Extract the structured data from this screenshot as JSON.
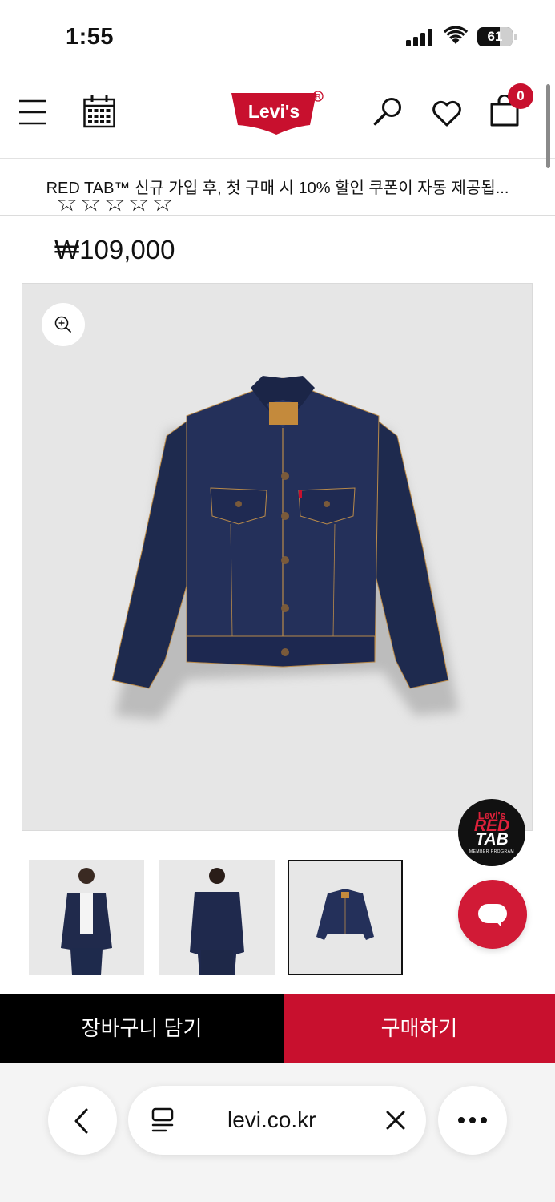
{
  "status_bar": {
    "time": "1:55",
    "battery": "61"
  },
  "header": {
    "menu_icon": "hamburger-icon",
    "calendar_icon": "calendar-icon",
    "logo_text": "Levi's",
    "search_icon": "search-icon",
    "wishlist_icon": "heart-icon",
    "cart_icon": "shopping-bag-icon",
    "cart_count": "0",
    "brand_color": "#c8102e"
  },
  "promo": {
    "text": "RED TAB™ 신규 가입 후, 첫 구매 시 10% 할인 쿠폰이 자동 제공됩..."
  },
  "product": {
    "rating_stars": [
      "☆",
      "☆",
      "☆",
      "☆",
      "☆"
    ],
    "price": "₩109,000",
    "zoom_icon": "zoom-in-icon"
  },
  "floating": {
    "red_tab_line1": "Levi's",
    "red_tab_line2": "RED",
    "red_tab_line3": "TAB",
    "red_tab_line4": "MEMBER PROGRAM",
    "chat_icon": "chat-bubble-icon"
  },
  "actions": {
    "add_to_cart": "장바구니 담기",
    "buy_now": "구매하기"
  },
  "browser": {
    "back_icon": "chevron-left-icon",
    "reader_icon": "reader-icon",
    "url": "levi.co.kr",
    "close_icon": "close-icon",
    "more_icon": "more-horizontal-icon"
  }
}
